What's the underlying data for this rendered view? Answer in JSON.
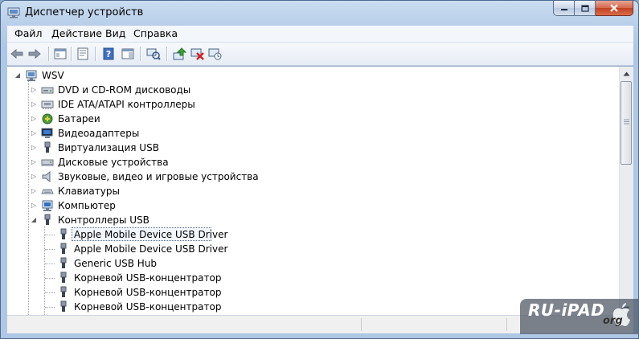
{
  "window": {
    "title": "Диспетчер устройств"
  },
  "menu": [
    "Файл",
    "Действие",
    "Вид",
    "Справка"
  ],
  "toolbar_icons": [
    "back-icon",
    "forward-icon",
    "show-hide-tree-icon",
    "properties-icon",
    "help-icon",
    "action-pane-icon",
    "scan-hardware-icon",
    "update-driver-icon",
    "uninstall-icon",
    "disable-icon"
  ],
  "tree": {
    "root": "WSV",
    "categories": [
      {
        "label": "DVD и CD-ROM дисководы",
        "icon": "dvd-drive-icon",
        "expanded": false
      },
      {
        "label": "IDE ATA/ATAPI контроллеры",
        "icon": "ide-controller-icon",
        "expanded": false
      },
      {
        "label": "Батареи",
        "icon": "battery-icon",
        "expanded": false
      },
      {
        "label": "Видеоадаптеры",
        "icon": "display-adapter-icon",
        "expanded": false
      },
      {
        "label": "Виртуализация USB",
        "icon": "usb-plug-icon",
        "expanded": false
      },
      {
        "label": "Дисковые устройства",
        "icon": "disk-drive-icon",
        "expanded": false
      },
      {
        "label": "Звуковые, видео и игровые устройства",
        "icon": "speaker-icon",
        "expanded": false
      },
      {
        "label": "Клавиатуры",
        "icon": "keyboard-icon",
        "expanded": false
      },
      {
        "label": "Компьютер",
        "icon": "computer-icon",
        "expanded": false
      },
      {
        "label": "Контроллеры USB",
        "icon": "usb-plug-icon",
        "expanded": true
      }
    ],
    "usb_children": [
      {
        "label": "Apple Mobile Device USB Driver",
        "selected": true
      },
      {
        "label": "Apple Mobile Device USB Driver",
        "selected": false
      },
      {
        "label": "Generic USB Hub",
        "selected": false
      },
      {
        "label": "Корневой USB-концентратор",
        "selected": false
      },
      {
        "label": "Корневой USB-концентратор",
        "selected": false
      },
      {
        "label": "Корневой USB-концентратор",
        "selected": false
      }
    ]
  },
  "watermark": {
    "main": "RU-iPAD",
    "sub": "org"
  },
  "colors": {
    "titlebar": "#c9dcf1",
    "close_button": "#c3401f",
    "selection_border": "#5a6e8a"
  }
}
